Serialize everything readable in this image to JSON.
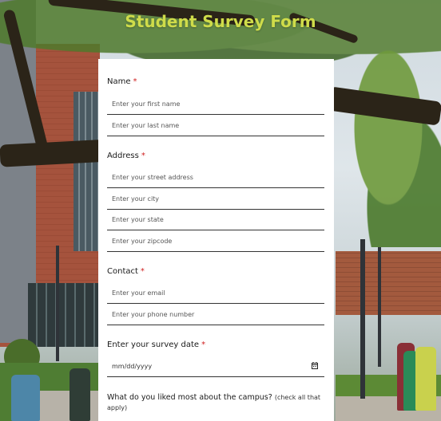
{
  "page": {
    "title": "Student Survey Form"
  },
  "form": {
    "name": {
      "label": "Name",
      "required_mark": "*",
      "fields": [
        {
          "placeholder": "Enter your first name"
        },
        {
          "placeholder": "Enter your last name"
        }
      ]
    },
    "address": {
      "label": "Address",
      "required_mark": "*",
      "fields": [
        {
          "placeholder": "Enter your street address"
        },
        {
          "placeholder": "Enter your city"
        },
        {
          "placeholder": "Enter your state"
        },
        {
          "placeholder": "Enter your zipcode"
        }
      ]
    },
    "contact": {
      "label": "Contact",
      "required_mark": "*",
      "fields": [
        {
          "placeholder": "Enter your email"
        },
        {
          "placeholder": "Enter your phone number"
        }
      ]
    },
    "survey_date": {
      "label": "Enter your survey date",
      "required_mark": "*",
      "value": "mm/dd/yyyy",
      "icon": "calendar-icon"
    },
    "liked_question": {
      "text": "What do you liked most about the campus?",
      "hint": "(check all that apply)"
    }
  },
  "colors": {
    "title": "#cfdc4a",
    "required": "#d02020",
    "card": "#ffffff"
  }
}
